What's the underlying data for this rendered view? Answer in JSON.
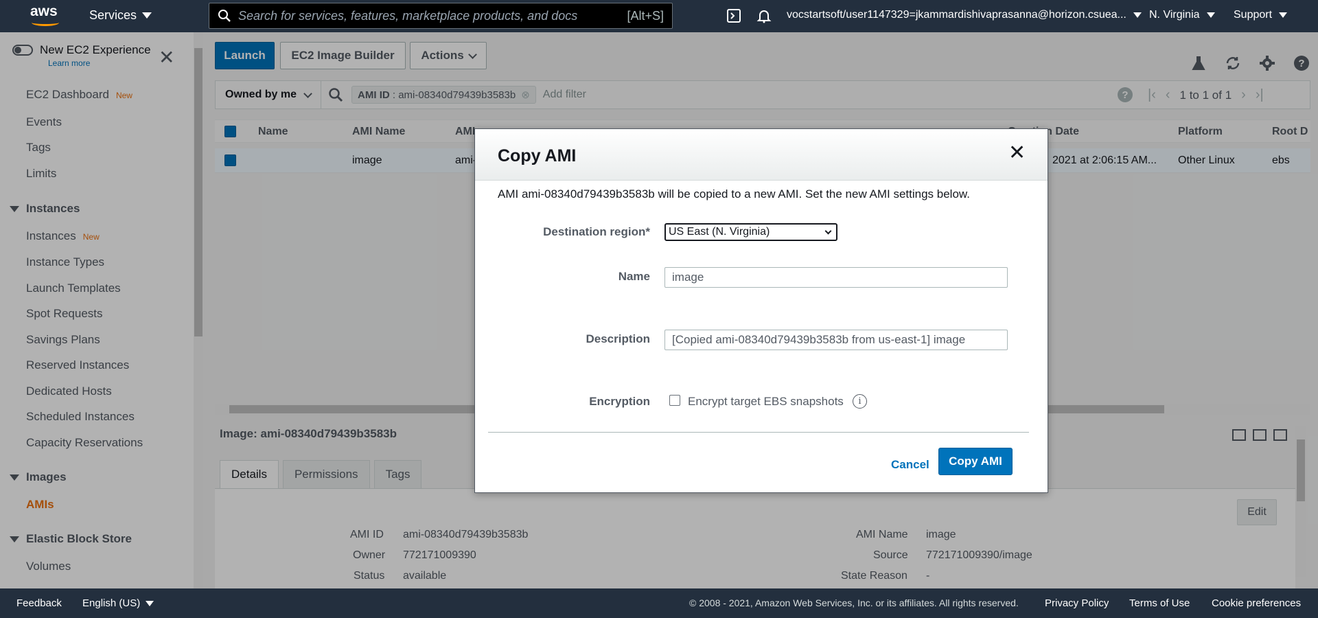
{
  "topnav": {
    "logo": "aws",
    "services_label": "Services",
    "search_placeholder": "Search for services, features, marketplace products, and docs",
    "search_shortcut": "[Alt+S]",
    "account": "vocstartsoft/user1147329=jkammardishivaprasanna@horizon.csuea...",
    "region": "N. Virginia",
    "support": "Support"
  },
  "sidebar": {
    "new_experience_label": "New EC2 Experience",
    "learn_more": "Learn more",
    "new_badge": "New",
    "items": [
      {
        "label": "EC2 Dashboard",
        "new": true
      },
      {
        "label": "Events"
      },
      {
        "label": "Tags"
      },
      {
        "label": "Limits"
      }
    ],
    "instances_section": "Instances",
    "instances_items": [
      {
        "label": "Instances",
        "new": true
      },
      {
        "label": "Instance Types"
      },
      {
        "label": "Launch Templates"
      },
      {
        "label": "Spot Requests"
      },
      {
        "label": "Savings Plans"
      },
      {
        "label": "Reserved Instances"
      },
      {
        "label": "Dedicated Hosts"
      },
      {
        "label": "Scheduled Instances"
      },
      {
        "label": "Capacity Reservations"
      }
    ],
    "images_section": "Images",
    "images_items": [
      {
        "label": "AMIs",
        "active": true
      }
    ],
    "ebs_section": "Elastic Block Store",
    "ebs_items": [
      {
        "label": "Volumes"
      }
    ]
  },
  "toolbar": {
    "launch": "Launch",
    "image_builder": "EC2 Image Builder",
    "actions": "Actions"
  },
  "filter": {
    "owned_by": "Owned by me",
    "chip_key": "AMI ID",
    "chip_value": ": ami-08340d79439b3583b",
    "add_filter": "Add filter",
    "pagination": "1 to 1 of 1"
  },
  "table": {
    "headers": [
      "Name",
      "AMI Name",
      "AMI",
      "Creation Date",
      "Platform",
      "Root D"
    ],
    "row": {
      "ami_name": "image",
      "ami_id_partial": "ami-",
      "creation_date": "2021 at 2:06:15 AM...",
      "platform": "Other Linux",
      "root_device": "ebs"
    }
  },
  "details": {
    "title": "Image: ami-08340d79439b3583b",
    "tabs": [
      "Details",
      "Permissions",
      "Tags"
    ],
    "edit": "Edit",
    "left": [
      {
        "label": "AMI ID",
        "value": "ami-08340d79439b3583b"
      },
      {
        "label": "Owner",
        "value": "772171009390"
      },
      {
        "label": "Status",
        "value": "available"
      }
    ],
    "right": [
      {
        "label": "AMI Name",
        "value": "image"
      },
      {
        "label": "Source",
        "value": "772171009390/image"
      },
      {
        "label": "State Reason",
        "value": "-"
      }
    ]
  },
  "modal": {
    "title": "Copy AMI",
    "intro": "AMI ami-08340d79439b3583b will be copied to a new AMI. Set the new AMI settings below.",
    "destination_label": "Destination region*",
    "destination_value": "US East (N. Virginia)",
    "name_label": "Name",
    "name_value": "image",
    "description_label": "Description",
    "description_value": "[Copied ami-08340d79439b3583b from us-east-1] image",
    "encryption_label": "Encryption",
    "encrypt_checkbox_label": "Encrypt target EBS snapshots",
    "info_icon": "i",
    "cancel": "Cancel",
    "copy": "Copy AMI"
  },
  "footer": {
    "feedback": "Feedback",
    "language": "English (US)",
    "copyright": "© 2008 - 2021, Amazon Web Services, Inc. or its affiliates. All rights reserved.",
    "privacy": "Privacy Policy",
    "terms": "Terms of Use",
    "cookies": "Cookie preferences"
  },
  "colors": {
    "nav_bg": "#232f3e",
    "primary": "#0073bb",
    "accent_orange": "#ec7211"
  }
}
